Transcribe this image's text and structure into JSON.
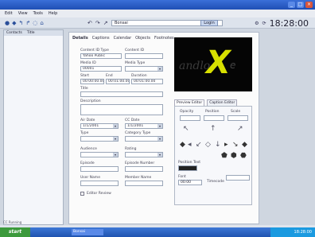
{
  "window": {
    "title": "",
    "controls": [
      "_",
      "□",
      "×"
    ]
  },
  "menu": [
    "Edit",
    "View",
    "Tools",
    "Help"
  ],
  "toolbar": {
    "address": "Bonsai",
    "go_label": "Login",
    "clock": "18:28:00"
  },
  "left_pane": {
    "tabs": [
      "Contacts",
      "Title"
    ]
  },
  "main": {
    "tabs": [
      "Details",
      "Captions",
      "Calendar",
      "Objects",
      "Footnotes"
    ],
    "fields": {
      "content_id_type_label": "Content ID Type",
      "content_id_type_value": "Yahoo Public",
      "content_label": "Content ID",
      "media_id_label": "Media ID",
      "media_id_value": "00001",
      "media_type_label": "Media Type",
      "start_label": "Start",
      "start_value": "00:00:00.00",
      "end_label": "End",
      "end_value": "00:01:00.00",
      "duration_label": "Duration",
      "duration_value": "00:01:00.00",
      "title_label": "Title",
      "description_label": "Description",
      "air_date_label": "Air Date",
      "air_date_value": "1/1/2001",
      "cc_date_label": "CC Date",
      "cc_date_value": "1/1/2001",
      "type_label": "Type",
      "category_type_label": "Category Type",
      "audience_label": "Audience",
      "rating_label": "Rating",
      "episode_label": "Episode",
      "episode_number_label": "Episode Number",
      "user_name_label": "User Name",
      "member_name_label": "Member Name",
      "editor_review_label": "Editor Review"
    }
  },
  "video": {
    "ghost_text": "andlo",
    "logo_letter": "X",
    "logo_tail": "e"
  },
  "player": {
    "tabs": [
      "Preview Editor",
      "Caption Editor"
    ],
    "labels": {
      "top_left": "Opacity",
      "top_mid": "Position",
      "top_right": "Scale",
      "bottom_label": "Position Text",
      "bottom_value": "",
      "left_label": "Font",
      "left_value": "00:00",
      "right_label": "Timecode"
    }
  },
  "taskbar": {
    "start": "start",
    "app": "Bonsai"
  },
  "status": {
    "text": "CC Running"
  }
}
